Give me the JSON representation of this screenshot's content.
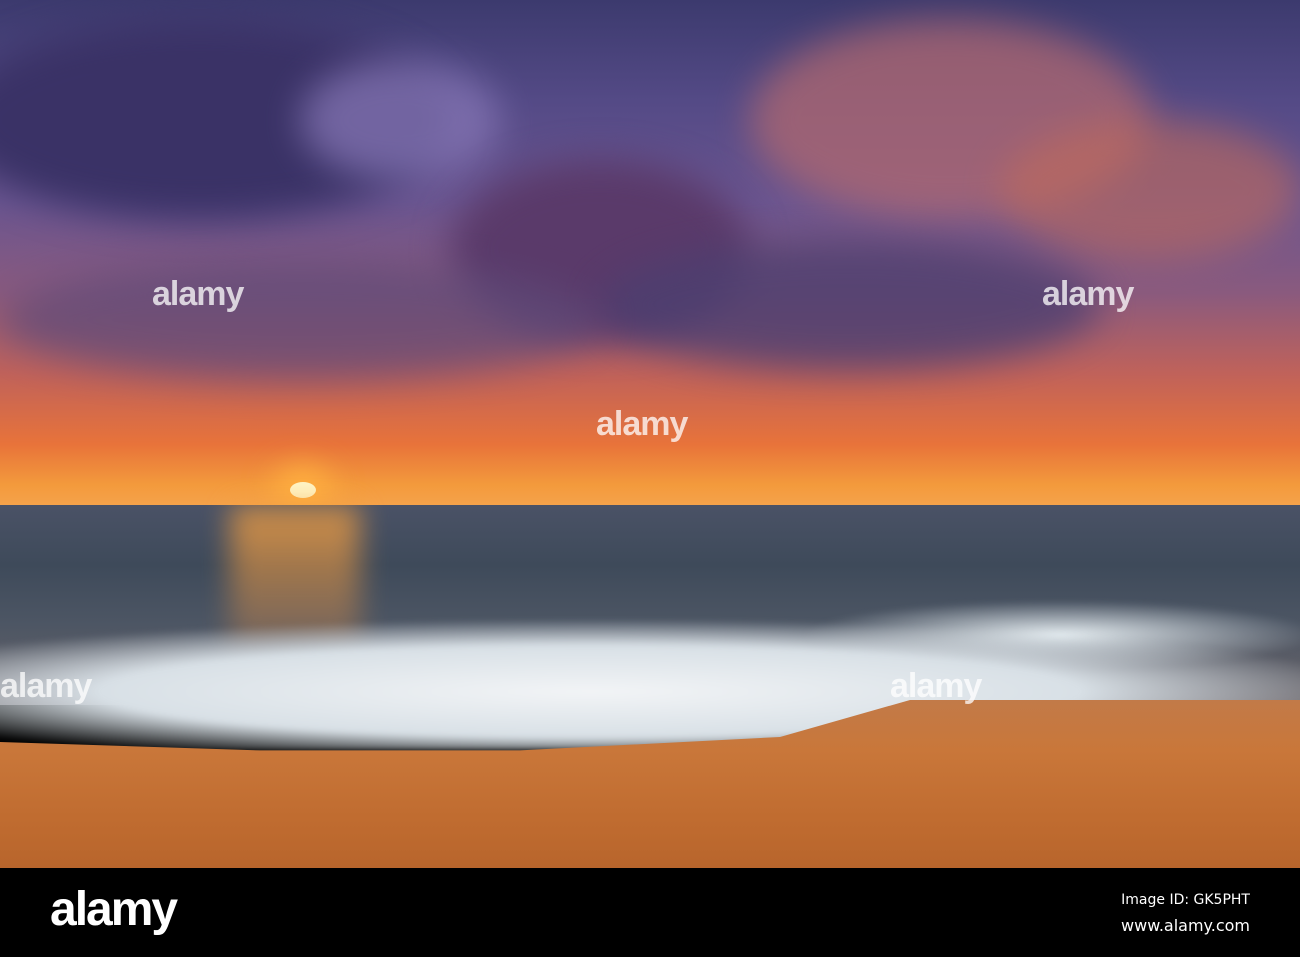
{
  "photo": {
    "description_tag": "alamy",
    "watermark_text": "alamy"
  },
  "footer": {
    "logo": "alamy",
    "image_id": "Image ID: GK5PHT",
    "website": "www.alamy.com"
  },
  "colors": {
    "sky_top": "#3c3a6e",
    "horizon": "#f39a3c",
    "sea": "#3e4a5a",
    "sand": "#c9773a",
    "footer": "#000000"
  }
}
